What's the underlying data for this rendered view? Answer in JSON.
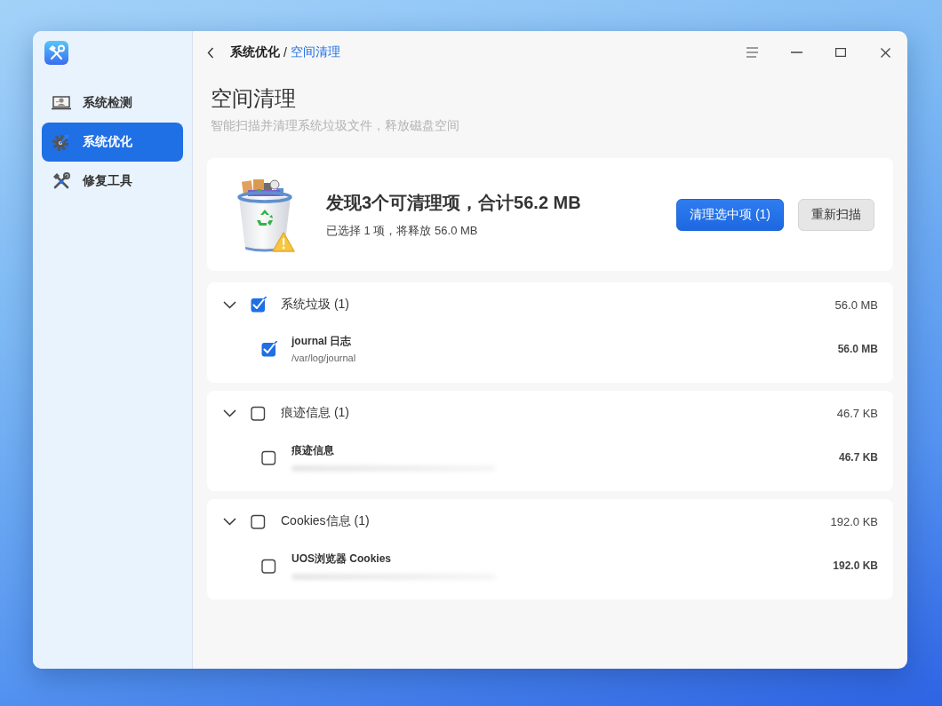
{
  "sidebar": {
    "items": [
      {
        "label": "系统检测",
        "selected": false
      },
      {
        "label": "系统优化",
        "selected": true
      },
      {
        "label": "修复工具",
        "selected": false
      }
    ]
  },
  "breadcrumb": {
    "items": [
      "系统优化",
      "空间清理"
    ],
    "separator": "/"
  },
  "page": {
    "title": "空间清理",
    "subtitle": "智能扫描并清理系统垃圾文件，释放磁盘空间"
  },
  "summary": {
    "headline": "发现3个可清理项，合计56.2 MB",
    "detail": "已选择 1 项，将释放 56.0 MB",
    "buttons": [
      {
        "label": "清理选中项 (1)",
        "kind": "primary"
      },
      {
        "label": "重新扫描",
        "kind": "secondary"
      }
    ]
  },
  "groups": [
    {
      "label": "系统垃圾 (1)",
      "size": "56.0 MB",
      "checked": true,
      "expanded": true,
      "items": [
        {
          "name": "journal 日志",
          "path": "/var/log/journal",
          "size": "56.0 MB",
          "checked": true,
          "blurred": false
        }
      ]
    },
    {
      "label": "痕迹信息 (1)",
      "size": "46.7 KB",
      "checked": false,
      "expanded": true,
      "items": [
        {
          "name": "痕迹信息",
          "size": "46.7 KB",
          "checked": false,
          "blurred": true
        }
      ]
    },
    {
      "label": "Cookies信息 (1)",
      "size": "192.0 KB",
      "checked": false,
      "expanded": true,
      "items": [
        {
          "name": "UOS浏览器 Cookies",
          "size": "192.0 KB",
          "checked": false,
          "blurred": true
        }
      ]
    }
  ]
}
